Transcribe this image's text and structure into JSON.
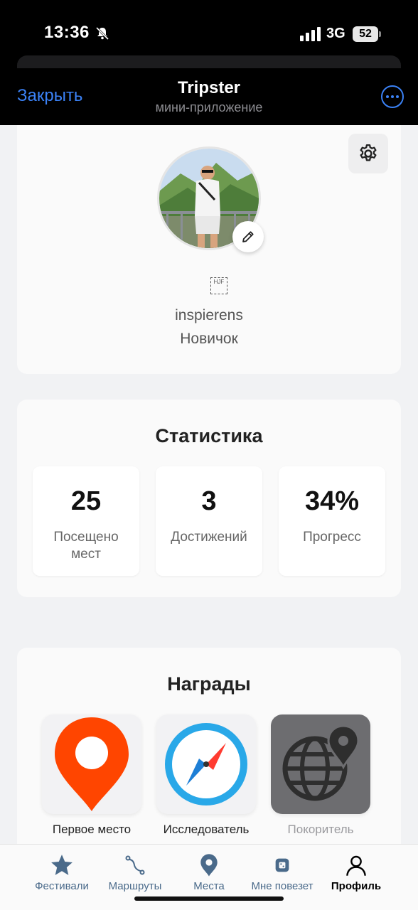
{
  "status_bar": {
    "time": "13:36",
    "network": "3G",
    "battery": "52"
  },
  "header": {
    "close_label": "Закрыть",
    "title": "Tripster",
    "subtitle": "мини-приложение",
    "accent_color": "#3b82f6"
  },
  "profile": {
    "username": "inspierens",
    "level": "Новичок",
    "glyph": "HJF"
  },
  "stats": {
    "title": "Статистика",
    "items": [
      {
        "value": "25",
        "label": "Посещено мест"
      },
      {
        "value": "3",
        "label": "Достижений"
      },
      {
        "value": "34%",
        "label": "Прогресс"
      }
    ]
  },
  "rewards": {
    "title": "Награды",
    "items": [
      {
        "label": "Первое место",
        "icon": "map-pin-icon",
        "locked": false
      },
      {
        "label": "Исследователь",
        "icon": "compass-icon",
        "locked": false
      },
      {
        "label": "Покоритель",
        "icon": "globe-pin-icon",
        "locked": true
      }
    ]
  },
  "tabbar": {
    "items": [
      {
        "label": "Фестивали",
        "icon": "star-icon"
      },
      {
        "label": "Маршруты",
        "icon": "route-icon"
      },
      {
        "label": "Места",
        "icon": "location-icon"
      },
      {
        "label": "Мне повезет",
        "icon": "dice-icon"
      },
      {
        "label": "Профиль",
        "icon": "user-icon",
        "active": true
      }
    ]
  }
}
